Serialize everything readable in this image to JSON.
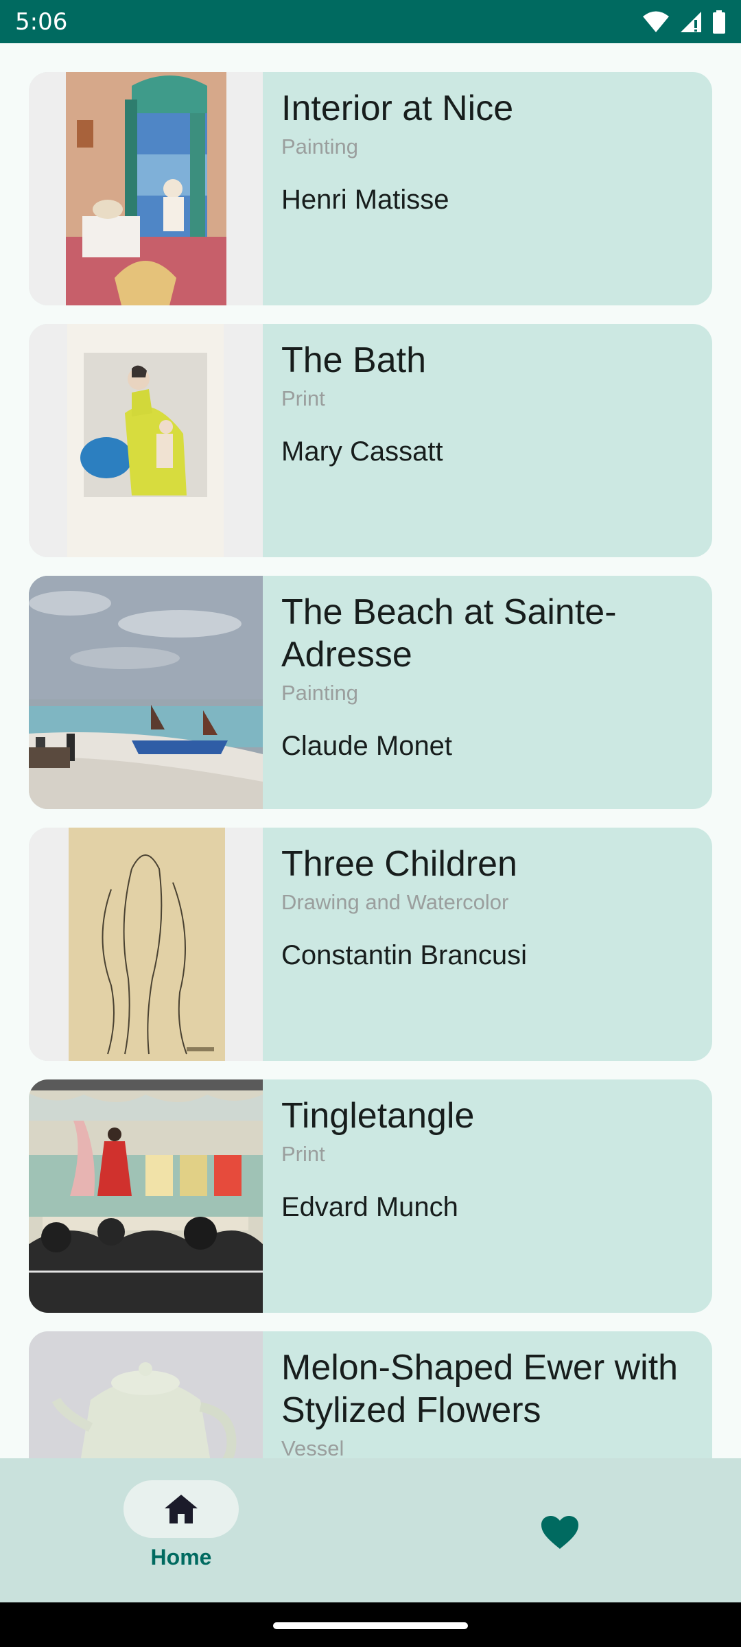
{
  "status_bar": {
    "time": "5:06",
    "icons": [
      "wifi-icon",
      "signal-icon",
      "battery-icon"
    ]
  },
  "artworks": [
    {
      "title": "Interior at Nice",
      "type": "Painting",
      "artist": "Henri Matisse"
    },
    {
      "title": "The Bath",
      "type": "Print",
      "artist": "Mary Cassatt"
    },
    {
      "title": "The Beach at Sainte-Adresse",
      "type": "Painting",
      "artist": "Claude Monet"
    },
    {
      "title": "Three Children",
      "type": "Drawing and Watercolor",
      "artist": "Constantin Brancusi"
    },
    {
      "title": "Tingletangle",
      "type": "Print",
      "artist": "Edvard Munch"
    },
    {
      "title": "Melon-Shaped Ewer with Stylized Flowers",
      "type": "Vessel",
      "artist": ""
    }
  ],
  "bottom_nav": {
    "home_label": "Home",
    "home_icon": "home-icon",
    "favorites_icon": "heart-icon",
    "selected": "Home"
  },
  "colors": {
    "accent": "#006a60",
    "card_background": "#cce8e2",
    "nav_background": "#c9e1dc",
    "secondary_text": "#9a9e9d"
  }
}
